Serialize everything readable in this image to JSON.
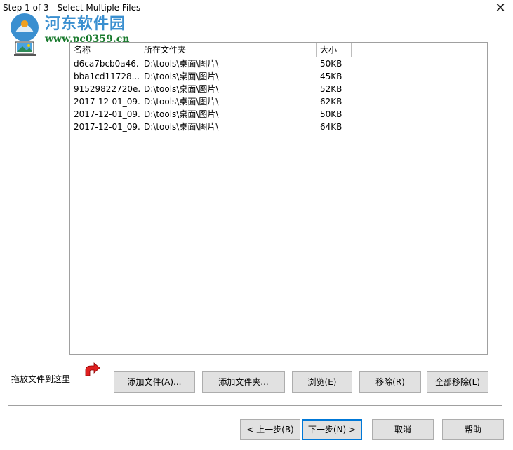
{
  "window": {
    "title": "Step 1 of 3 - Select Multiple Files",
    "close_symbol": "✕"
  },
  "watermark": {
    "text": "河东软件园",
    "url": "www.pc0359.cn"
  },
  "list": {
    "columns": [
      "名称",
      "所在文件夹",
      "大小"
    ],
    "rows": [
      {
        "name": "d6ca7bcb0a46...",
        "folder": "D:\\tools\\桌面\\图片\\",
        "size": "50KB"
      },
      {
        "name": "bba1cd11728...",
        "folder": "D:\\tools\\桌面\\图片\\",
        "size": "45KB"
      },
      {
        "name": "91529822720e...",
        "folder": "D:\\tools\\桌面\\图片\\",
        "size": "52KB"
      },
      {
        "name": "2017-12-01_09...",
        "folder": "D:\\tools\\桌面\\图片\\",
        "size": "62KB"
      },
      {
        "name": "2017-12-01_09...",
        "folder": "D:\\tools\\桌面\\图片\\",
        "size": "50KB"
      },
      {
        "name": "2017-12-01_09...",
        "folder": "D:\\tools\\桌面\\图片\\",
        "size": "64KB"
      }
    ]
  },
  "drop_label": "拖放文件到这里",
  "actions": {
    "add_files": "添加文件(A)...",
    "add_folder": "添加文件夹...",
    "browse": "浏览(E)",
    "remove": "移除(R)",
    "remove_all": "全部移除(L)"
  },
  "nav": {
    "back": "< 上一步(B)",
    "next": "下一步(N) >",
    "cancel": "取消",
    "help": "帮助"
  },
  "colors": {
    "accent": "#0078d7",
    "watermark_blue": "#3a8fd0",
    "watermark_green": "#1a7a2e",
    "arrow_red": "#e02020"
  }
}
